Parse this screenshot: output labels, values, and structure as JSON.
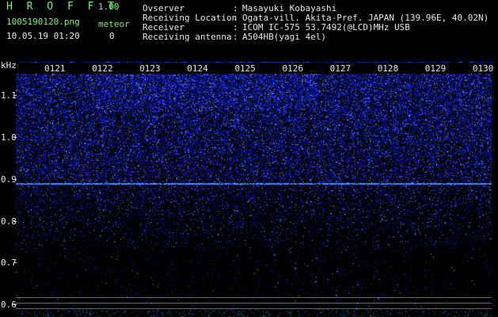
{
  "header": {
    "brand": "H R O F F T",
    "version": "1.00",
    "filename": "1005190120.png",
    "meteor_label": "meteor",
    "datetime": "10.05.19 01:20",
    "meteor_count": "0"
  },
  "info": [
    {
      "key": "Ovserver",
      "value": "Masayuki Kobayashi"
    },
    {
      "key": "Receiving Location",
      "value": "Ogata-vill. Akita-Pref. JAPAN (139.96E, 40.02N)"
    },
    {
      "key": "Receiver",
      "value": "ICOM IC-575 53.7492(@LCD)MHz USB"
    },
    {
      "key": "Receiving antenna",
      "value": "A504HB(yagi 4el)"
    }
  ],
  "chart_data": {
    "type": "heatmap",
    "ylabel": "kHz",
    "ylim": [
      0.57,
      1.18
    ],
    "yticks": [
      "1.1",
      "1.0",
      "0.9",
      "0.8",
      "0.7",
      "0.6"
    ],
    "ytick_values": [
      1.1,
      1.0,
      0.9,
      0.8,
      0.7,
      0.6
    ],
    "xticks": [
      "0121",
      "0122",
      "0123",
      "0124",
      "0125",
      "0126",
      "0127",
      "0128",
      "0129",
      "0130"
    ],
    "carrier_line_khz": 0.89,
    "reference_lines_khz": [
      0.618,
      0.605,
      0.59
    ],
    "colormap": [
      "#000000",
      "#0a1a8c",
      "#2244ff",
      "#88aaff"
    ],
    "grid": false
  }
}
